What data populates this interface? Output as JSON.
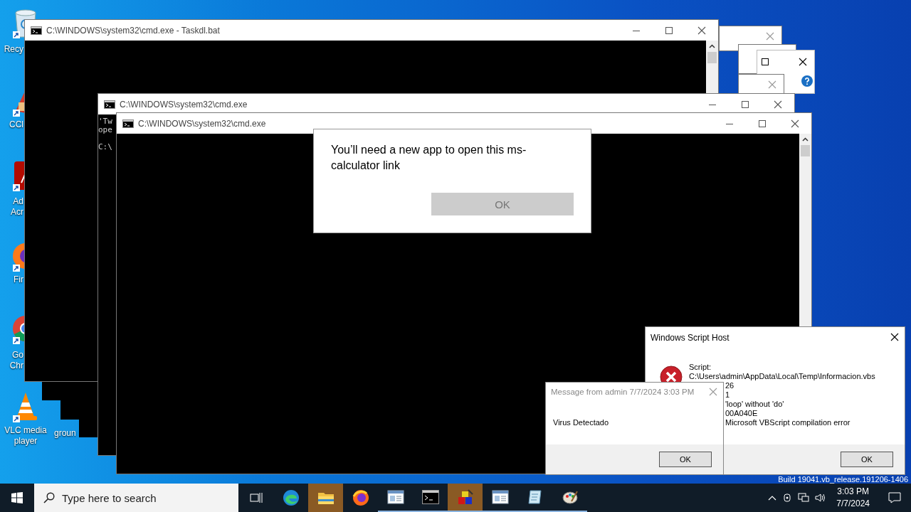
{
  "desktop_icons": [
    {
      "kind": "recycle",
      "lines": [
        "Recy"
      ]
    },
    {
      "kind": "cleaner",
      "lines": [
        "CCl"
      ]
    },
    {
      "kind": "acrobat",
      "lines": [
        "Ad",
        "Acr"
      ]
    },
    {
      "kind": "firefox",
      "lines": [
        "Fir"
      ]
    },
    {
      "kind": "chrome",
      "lines": [
        "Go",
        "Chr"
      ]
    },
    {
      "kind": "vlc",
      "lines": [
        "VLC media",
        "player"
      ]
    },
    {
      "kind": "blank",
      "lines": [
        "groun"
      ]
    }
  ],
  "build_text": "Build 19041.vb_release.191206-1406",
  "console_windows": [
    {
      "title": "C:\\WINDOWS\\system32\\cmd.exe - Taskdl.bat"
    },
    {
      "title": "C:\\WINDOWS\\system32\\cmd.exe",
      "lines": [
        "'Tw",
        "ope",
        "C:\\"
      ]
    },
    {
      "title": "C:\\WINDOWS\\system32\\cmd.exe"
    }
  ],
  "app_prompt": {
    "message": "You’ll need a new app to open this ms-calculator link",
    "button": "OK"
  },
  "script_host": {
    "title": "Windows Script Host",
    "lines": [
      "Script:",
      "C:\\Users\\admin\\AppData\\Local\\Temp\\Informacion.vbs",
      "26",
      "1",
      "'loop' without 'do'",
      "00A040E",
      "Microsoft VBScript compilation error"
    ],
    "button": "OK"
  },
  "message_box": {
    "title": "Message from admin 7/7/2024 3:03 PM",
    "text": "Virus Detectado",
    "button": "OK"
  },
  "taskbar": {
    "search_placeholder": "Type here to search",
    "apps": [
      {
        "kind": "task-view",
        "running": false,
        "flashing": false
      },
      {
        "kind": "edge",
        "running": false,
        "flashing": false
      },
      {
        "kind": "folder",
        "running": false,
        "flashing": true
      },
      {
        "kind": "firefox",
        "running": false,
        "flashing": false
      },
      {
        "kind": "window",
        "running": true,
        "flashing": false
      },
      {
        "kind": "console",
        "running": true,
        "flashing": false
      },
      {
        "kind": "blocks",
        "running": true,
        "flashing": true
      },
      {
        "kind": "window",
        "running": true,
        "flashing": false
      },
      {
        "kind": "notepad",
        "running": true,
        "flashing": false
      },
      {
        "kind": "palette",
        "running": true,
        "flashing": false
      }
    ],
    "time": "3:03 PM",
    "date": "7/7/2024"
  }
}
